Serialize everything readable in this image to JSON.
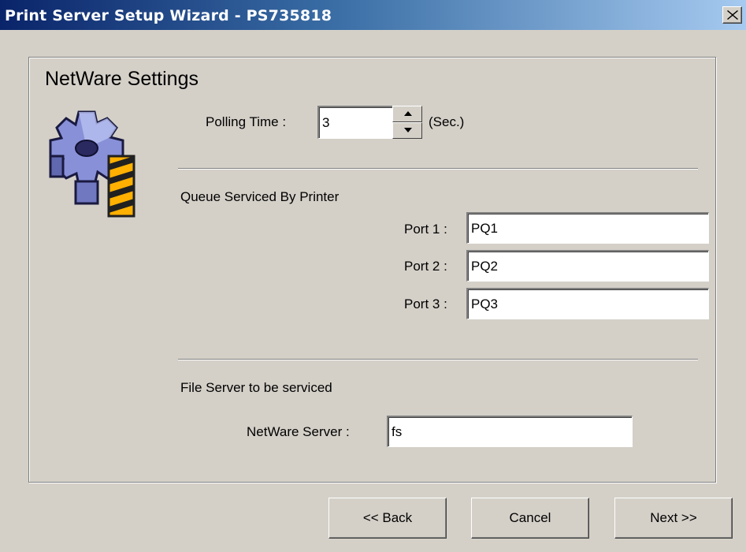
{
  "window": {
    "title": "Print Server Setup Wizard - PS735818",
    "close_icon": "close-icon"
  },
  "page": {
    "heading": "NetWare Settings",
    "icon": "gear-icon"
  },
  "polling": {
    "label": "Polling Time :",
    "value": "3",
    "unit": "(Sec.)"
  },
  "queue": {
    "heading": "Queue Serviced By Printer",
    "ports": [
      {
        "label": "Port 1 :",
        "value": "PQ1"
      },
      {
        "label": "Port 2 :",
        "value": "PQ2"
      },
      {
        "label": "Port 3 :",
        "value": "PQ3"
      }
    ]
  },
  "file_server": {
    "heading": "File Server to be serviced",
    "label": "NetWare Server :",
    "value": "fs"
  },
  "buttons": {
    "back": "<< Back",
    "cancel": "Cancel",
    "next": "Next >>"
  }
}
